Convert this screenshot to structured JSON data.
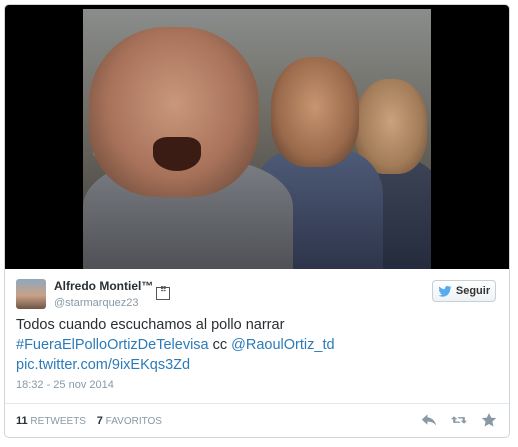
{
  "tweet": {
    "author": {
      "name": "Alfredo Montiel™",
      "badge": "☷",
      "handle": "@starmarquez23"
    },
    "follow_label": "Seguir",
    "text_plain": "Todos cuando escuchamos al pollo narrar",
    "hashtag": "#FueraElPolloOrtizDeTelevisa",
    "cc": "cc",
    "mention": "@RaoulOrtiz_td",
    "pic_link": "pic.twitter.com/9ixEKqs3Zd",
    "timestamp": "18:32 - 25 nov 2014",
    "retweets_count": "11",
    "retweets_label": "RETWEETS",
    "favorites_count": "7",
    "favorites_label": "FAVORITOS"
  },
  "icons": {
    "reply": "reply-icon",
    "retweet": "retweet-icon",
    "favorite": "star-icon",
    "follow": "twitter-bird-icon"
  },
  "colors": {
    "link": "#2b7bb9",
    "muted": "#8899a6",
    "action_icon": "#8899a6",
    "bird": "#55acee"
  }
}
